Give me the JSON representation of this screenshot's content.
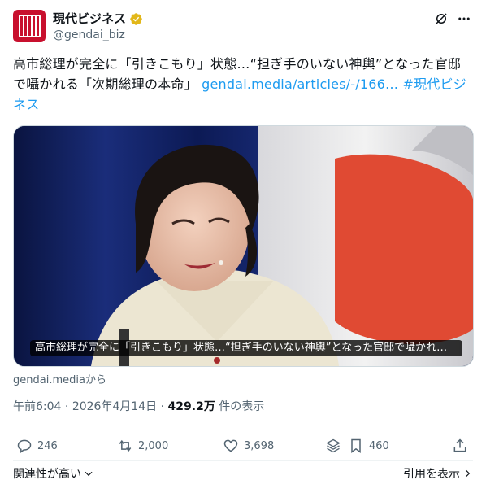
{
  "account": {
    "display_name": "現代ビジネス",
    "handle": "@gendai_biz",
    "brand_color": "#c8102e",
    "verified_color": "#e2b719"
  },
  "tweet": {
    "text": "高市総理が完全に「引きこもり」状態…“担ぎ手のいない神輿”となった官邸で囁かれる「次期総理の本命」 ",
    "link": "gendai.media/articles/-/166…",
    "hashtag": "#現代ビジネス",
    "link_color": "#1d9bf0"
  },
  "media": {
    "caption": "高市総理が完全に「引きこもり」状態…“担ぎ手のいない神輿”となった官邸で囁かれる…",
    "source": "gendai.mediaから"
  },
  "meta": {
    "time": "午前6:04",
    "date": "2026年4月14日",
    "views": "429.2万",
    "views_suffix": "件の表示"
  },
  "actions": {
    "replies": "246",
    "reposts": "2,000",
    "likes": "3,698",
    "bookmarks": "460"
  },
  "footer": {
    "sort_label": "関連性が高い",
    "quotes_label": "引用を表示"
  }
}
